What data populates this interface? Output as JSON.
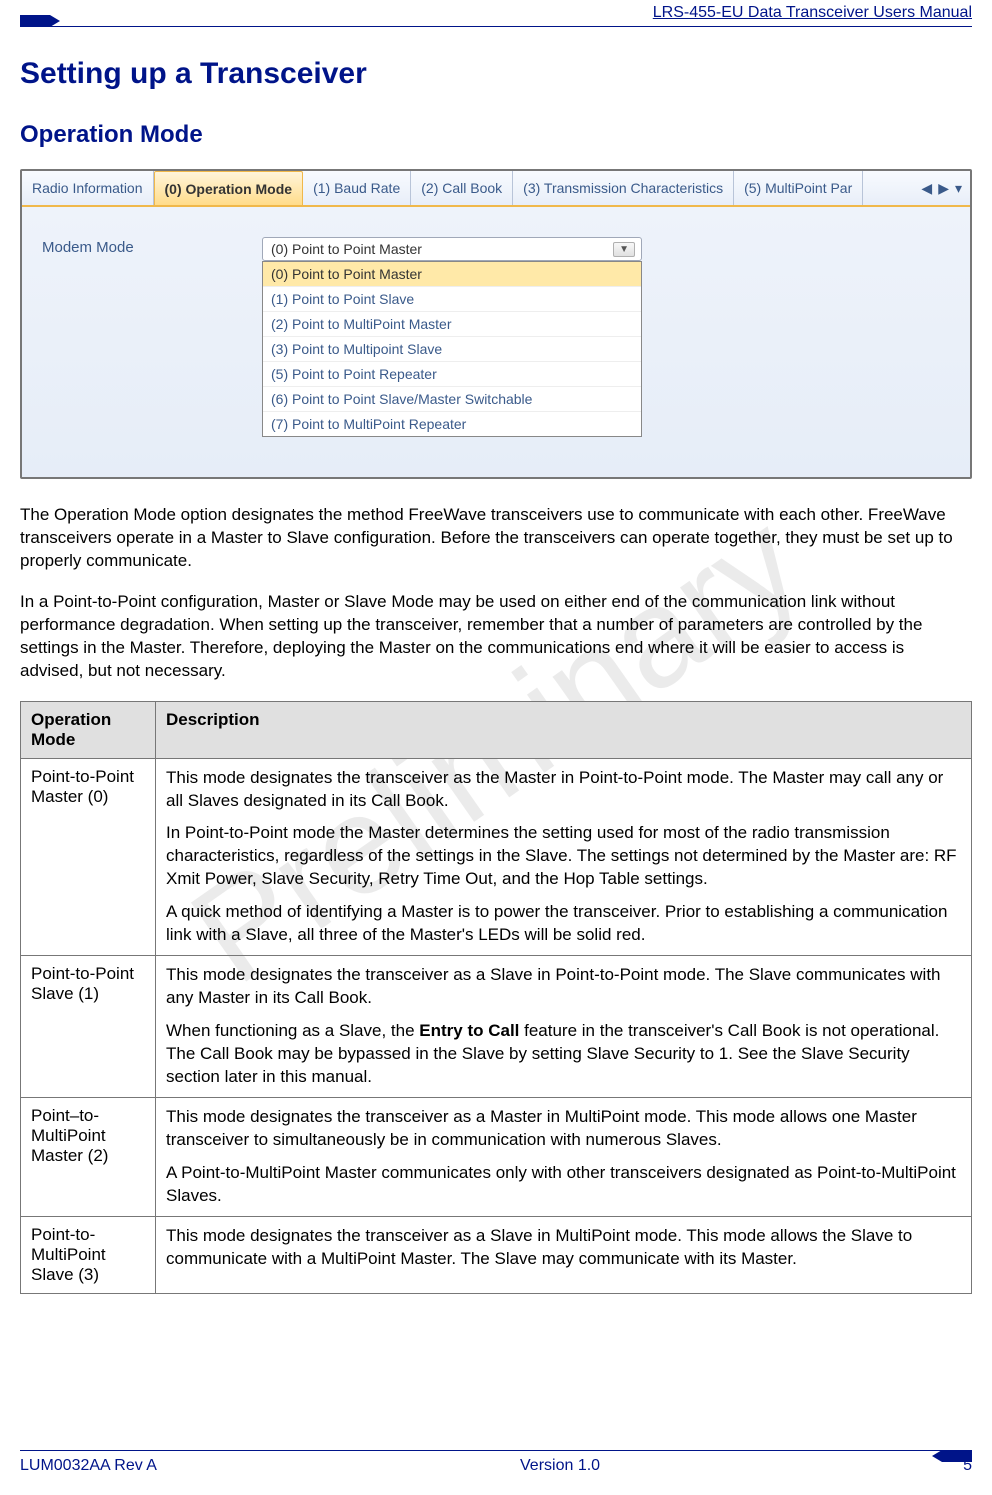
{
  "header": {
    "title": "LRS-455-EU Data Transceiver Users Manual"
  },
  "watermark": "Preliminary",
  "headings": {
    "h1": "Setting up a Transceiver",
    "h2": "Operation Mode"
  },
  "screenshot": {
    "tabs": [
      "Radio Information",
      "(0) Operation Mode",
      "(1) Baud Rate",
      "(2) Call Book",
      "(3) Transmission Characteristics",
      "(5) MultiPoint Par"
    ],
    "active_tab_index": 1,
    "field_label": "Modem Mode",
    "dropdown_selected": "(0) Point to Point Master",
    "dropdown_items": [
      "(0) Point to Point Master",
      "(1) Point to Point Slave",
      "(2) Point to MultiPoint Master",
      "(3) Point to Multipoint Slave",
      "(5) Point to Point Repeater",
      "(6) Point to Point Slave/Master Switchable",
      "(7) Point to MultiPoint Repeater"
    ]
  },
  "paragraphs": {
    "p1": "The Operation Mode option designates the method FreeWave transceivers use to communicate with each other. FreeWave transceivers operate in a Master to Slave configuration. Before the transceivers can operate together, they must be set up to properly communicate.",
    "p2": "In a Point-to-Point configuration, Master or Slave Mode may be used on either end of the communication link without performance degradation. When setting up the transceiver, remember that a number of parameters are controlled by the settings in the Master. Therefore, deploying the Master on the communications end where it will be easier to access is advised, but not necessary."
  },
  "table": {
    "headers": {
      "col1": "Operation Mode",
      "col2": "Description"
    },
    "rows": [
      {
        "mode": "Point-to-Point Master (0)",
        "desc": [
          "This mode designates the transceiver as the Master in Point-to-Point mode. The Master may call any or all Slaves designated in its Call Book.",
          "In Point-to-Point mode the Master determines the setting used for most of the radio transmission characteristics, regardless of the settings in the Slave. The settings not determined by the Master are: RF Xmit Power, Slave Security, Retry Time Out, and the Hop Table settings.",
          "A quick method of identifying a Master is to power the transceiver. Prior to establishing a communication link with a Slave, all three of the Master's LEDs will be solid red."
        ]
      },
      {
        "mode": "Point-to-Point Slave (1)",
        "desc_html": "This mode designates the transceiver as a Slave in Point-to-Point mode. The Slave communicates with any Master in its Call Book.|||When functioning as a Slave, the <b>Entry to Call</b> feature in the transceiver's Call Book is not operational. The Call Book may be bypassed in the Slave by setting Slave Security to 1. See the Slave Security section later in this manual."
      },
      {
        "mode": "Point–to-MultiPoint Master (2)",
        "desc": [
          "This mode designates the transceiver as a Master in MultiPoint mode. This mode allows one Master transceiver to simultaneously be in communication with numerous Slaves.",
          "A Point-to-MultiPoint Master communicates only with other transceivers designated as Point-to-MultiPoint Slaves."
        ]
      },
      {
        "mode": "Point-to-MultiPoint Slave (3)",
        "desc": [
          "This mode designates the transceiver as a Slave in MultiPoint mode. This mode allows the Slave to communicate with a MultiPoint Master. The Slave may communicate with its Master."
        ]
      }
    ]
  },
  "footer": {
    "left": "LUM0032AA Rev A",
    "center": "Version 1.0",
    "right": "5"
  }
}
